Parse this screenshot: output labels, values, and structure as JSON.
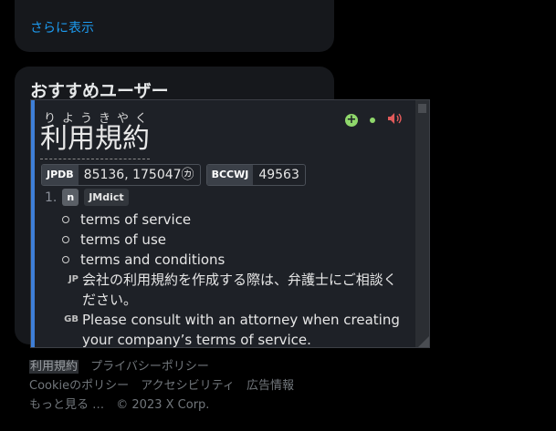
{
  "trends_card": {
    "show_more": "さらに表示"
  },
  "recommend_card": {
    "title": "おすすめユーザー"
  },
  "popup": {
    "reading": "りようきやく",
    "term": "利用規約",
    "frequencies": [
      {
        "tag": "JPDB",
        "value": "85136, 175047㋕"
      },
      {
        "tag": "BCCWJ",
        "value": "49563"
      }
    ],
    "sense": {
      "number": "1.",
      "pos": "n",
      "dictionary": "JMdict",
      "glosses": [
        "terms of service",
        "terms of use",
        "terms and conditions"
      ]
    },
    "examples": {
      "ja": {
        "lang": "JP",
        "text": "会社の利用規約を作成する際は、弁護士にご相談ください。"
      },
      "en": {
        "lang": "GB",
        "text": "Please consult with an attorney when creating your company’s terms of service."
      }
    },
    "icons": {
      "add": "add-note-icon",
      "status": "status-dot-icon",
      "audio": "speaker-icon"
    },
    "accent_color": "#3e7fd8"
  },
  "footer": {
    "row1": [
      "利用規約",
      "プライバシーポリシー"
    ],
    "row2": [
      "Cookieのポリシー",
      "アクセシビリティ",
      "広告情報"
    ],
    "row3": [
      "もっと見る …",
      "© 2023 X Corp."
    ]
  }
}
